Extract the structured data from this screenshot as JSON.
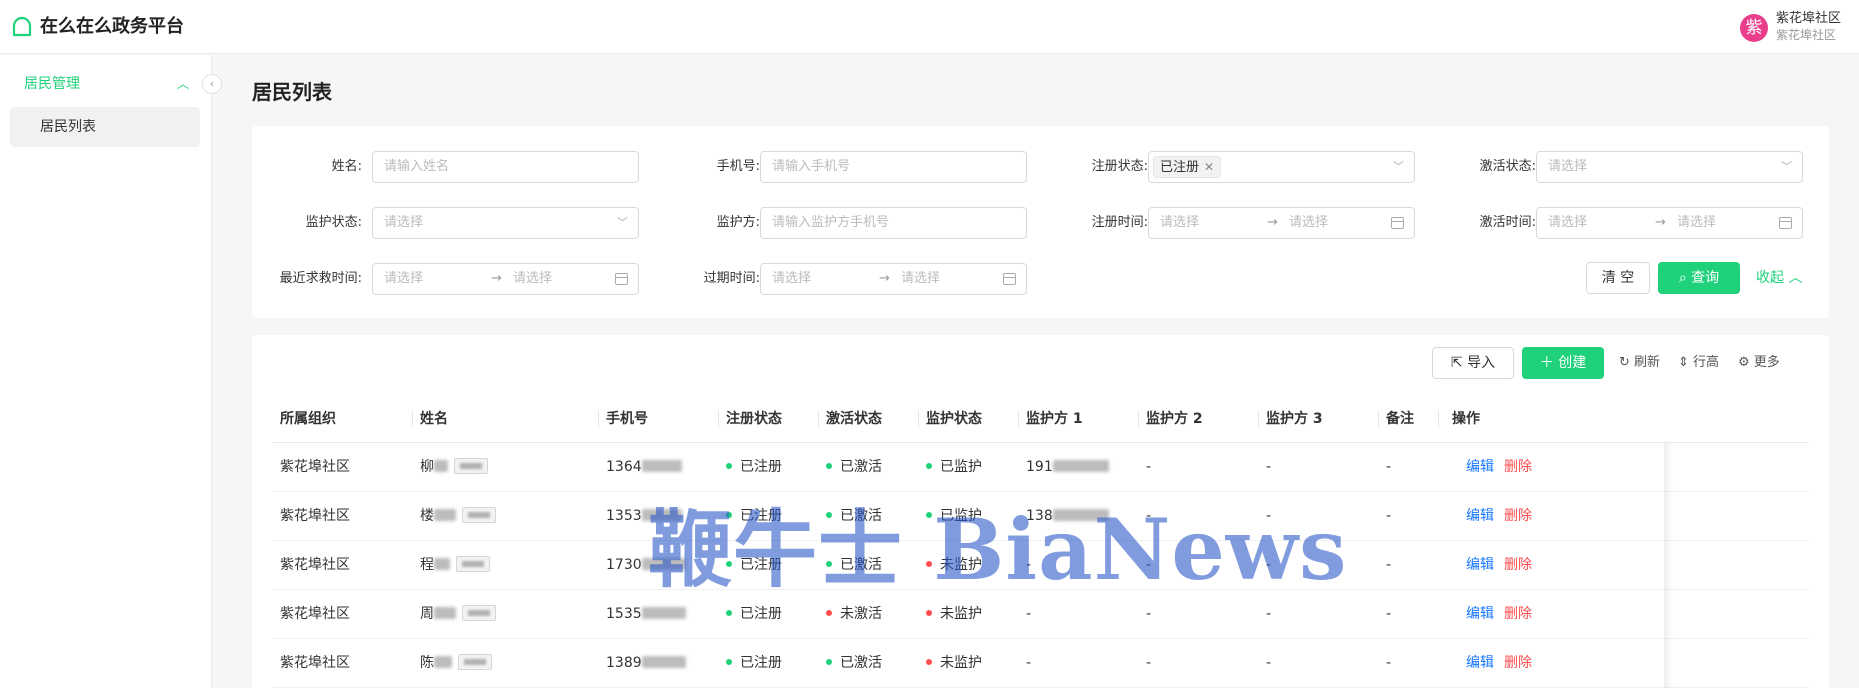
{
  "header": {
    "app_title": "在么在么政务平台",
    "avatar_text": "紫",
    "user_name": "紫花埠社区",
    "user_org": "紫花埠社区"
  },
  "sidebar": {
    "group_label": "居民管理",
    "items": [
      {
        "label": "居民列表",
        "active": true
      }
    ]
  },
  "page_title": "居民列表",
  "filters": {
    "name": {
      "label": "姓名:",
      "placeholder": "请输入姓名"
    },
    "phone": {
      "label": "手机号:",
      "placeholder": "请输入手机号"
    },
    "reg_status": {
      "label": "注册状态:",
      "value": "已注册"
    },
    "act_status": {
      "label": "激活状态:",
      "placeholder": "请选择"
    },
    "mon_status": {
      "label": "监护状态:",
      "placeholder": "请选择"
    },
    "guardian": {
      "label": "监护方:",
      "placeholder": "请输入监护方手机号"
    },
    "reg_time": {
      "label": "注册时间:",
      "start": "请选择",
      "end": "请选择"
    },
    "act_time": {
      "label": "激活时间:",
      "start": "请选择",
      "end": "请选择"
    },
    "sos_time": {
      "label": "最近求救时间:",
      "start": "请选择",
      "end": "请选择"
    },
    "exp_time": {
      "label": "过期时间:",
      "start": "请选择",
      "end": "请选择"
    },
    "range_arrow": "→",
    "clear_label": "清 空",
    "query_label": "查询",
    "collapse_label": "收起"
  },
  "toolbar": {
    "import_label": "导入",
    "create_label": "创建",
    "refresh_label": "刷新",
    "density_label": "行高",
    "more_label": "更多"
  },
  "table": {
    "columns": [
      "所属组织",
      "姓名",
      "手机号",
      "注册状态",
      "激活状态",
      "监护状态",
      "监护方 1",
      "监护方 2",
      "监护方 3",
      "备注",
      "操作"
    ],
    "rows": [
      {
        "org": "紫花埠社区",
        "name": "柳",
        "phone": "1364",
        "reg": "已注册",
        "act": "已激活",
        "act_ok": true,
        "mon": "已监护",
        "mon_ok": true,
        "g1": "191",
        "g2": "-",
        "g3": "-",
        "note": "-"
      },
      {
        "org": "紫花埠社区",
        "name": "楼",
        "phone": "1353",
        "reg": "已注册",
        "act": "已激活",
        "act_ok": true,
        "mon": "已监护",
        "mon_ok": true,
        "g1": "138",
        "g2": "-",
        "g3": "-",
        "note": "-"
      },
      {
        "org": "紫花埠社区",
        "name": "程",
        "phone": "1730",
        "reg": "已注册",
        "act": "已激活",
        "act_ok": true,
        "mon": "未监护",
        "mon_ok": false,
        "g1": "-",
        "g2": "-",
        "g3": "-",
        "note": "-"
      },
      {
        "org": "紫花埠社区",
        "name": "周",
        "phone": "1535",
        "reg": "已注册",
        "act": "未激活",
        "act_ok": false,
        "mon": "未监护",
        "mon_ok": false,
        "g1": "-",
        "g2": "-",
        "g3": "-",
        "note": "-"
      },
      {
        "org": "紫花埠社区",
        "name": "陈",
        "phone": "1389",
        "reg": "已注册",
        "act": "已激活",
        "act_ok": true,
        "mon": "未监护",
        "mon_ok": false,
        "g1": "-",
        "g2": "-",
        "g3": "-",
        "note": "-"
      }
    ],
    "edit_label": "编辑",
    "delete_label": "删除"
  },
  "colors": {
    "accent": "#1fd17a",
    "ok": "#1fd17a",
    "bad": "#ff4d4f",
    "link": "#1677ff",
    "danger": "#ff4d4f"
  },
  "watermark": "鞭牛士 BiaNews"
}
